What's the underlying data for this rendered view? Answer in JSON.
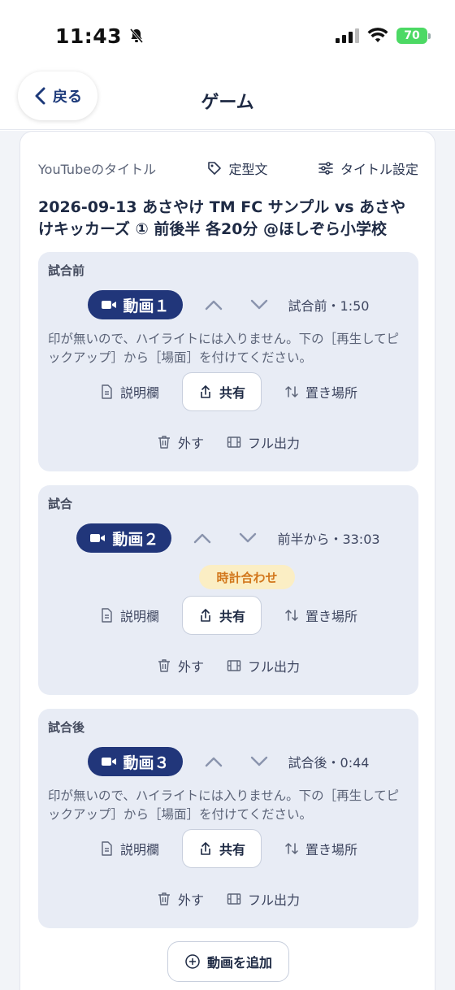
{
  "status_bar": {
    "time": "11:43",
    "battery": "70"
  },
  "nav": {
    "back_label": "戻る",
    "title": "ゲーム"
  },
  "title_row": {
    "label": "YouTubeのタイトル",
    "template_label": "定型文",
    "settings_label": "タイトル設定"
  },
  "video_title": "2026-09-13 あさやけ TM FC サンプル vs あさやけキッカーズ ① 前後半 各20分 @ほしぞら小学校",
  "segments": [
    {
      "label": "試合前",
      "video_label": "動画１",
      "time": "試合前・1:50",
      "note": "印が無いので、ハイライトには入りません。下の［再生してピックアップ］から［場面］を付けてください。",
      "description": "説明欄",
      "share": "共有",
      "placement": "置き場所",
      "remove": "外す",
      "full_output": "フル出力"
    },
    {
      "label": "試合",
      "video_label": "動画２",
      "time": "前半から・33:03",
      "badge": "時計合わせ",
      "description": "説明欄",
      "share": "共有",
      "placement": "置き場所",
      "remove": "外す",
      "full_output": "フル出力"
    },
    {
      "label": "試合後",
      "video_label": "動画３",
      "time": "試合後・0:44",
      "note": "印が無いので、ハイライトには入りません。下の［再生してピックアップ］から［場面］を付けてください。",
      "description": "説明欄",
      "share": "共有",
      "placement": "置き場所",
      "remove": "外す",
      "full_output": "フル出力"
    }
  ],
  "add_video_label": "動画を追加",
  "colors": {
    "accent": "#21367a",
    "badge_bg": "#fbeec4",
    "badge_text": "#d2771c",
    "segment_bg": "#e8ecf5"
  }
}
